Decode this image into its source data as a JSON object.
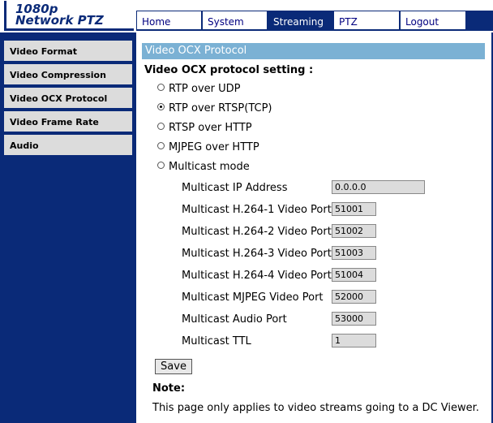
{
  "header": {
    "logo_line1": "1080p",
    "logo_line2": "Network PTZ",
    "nav": [
      {
        "label": "Home",
        "active": false
      },
      {
        "label": "System",
        "active": false
      },
      {
        "label": "Streaming",
        "active": true
      },
      {
        "label": "PTZ",
        "active": false
      },
      {
        "label": "Logout",
        "active": false
      }
    ]
  },
  "sidebar": {
    "items": [
      {
        "label": "Video Format"
      },
      {
        "label": "Video Compression"
      },
      {
        "label": "Video OCX Protocol"
      },
      {
        "label": "Video Frame Rate"
      },
      {
        "label": "Audio"
      }
    ]
  },
  "main": {
    "title": "Video OCX Protocol",
    "setting_label": "Video OCX protocol setting :",
    "options": [
      {
        "label": "RTP over UDP",
        "checked": false
      },
      {
        "label": "RTP over RTSP(TCP)",
        "checked": true
      },
      {
        "label": "RTSP over HTTP",
        "checked": false
      },
      {
        "label": "MJPEG over HTTP",
        "checked": false
      },
      {
        "label": "Multicast mode",
        "checked": false
      }
    ],
    "multicast_fields": [
      {
        "label": "Multicast IP Address",
        "value": "0.0.0.0"
      },
      {
        "label": "Multicast H.264-1 Video Port",
        "value": "51001"
      },
      {
        "label": "Multicast H.264-2 Video Port",
        "value": "51002"
      },
      {
        "label": "Multicast H.264-3 Video Port",
        "value": "51003"
      },
      {
        "label": "Multicast H.264-4 Video Port",
        "value": "51004"
      },
      {
        "label": "Multicast MJPEG Video Port",
        "value": "52000"
      },
      {
        "label": "Multicast Audio Port",
        "value": "53000"
      },
      {
        "label": "Multicast TTL",
        "value": "1"
      }
    ],
    "save_label": "Save",
    "note_title": "Note:",
    "note_text": "This page only applies to video streams going to a DC Viewer."
  },
  "colors": {
    "navy": "#0a2a78",
    "title_bar": "#7bb1d4",
    "sidebar_item": "#dcdcdc"
  }
}
